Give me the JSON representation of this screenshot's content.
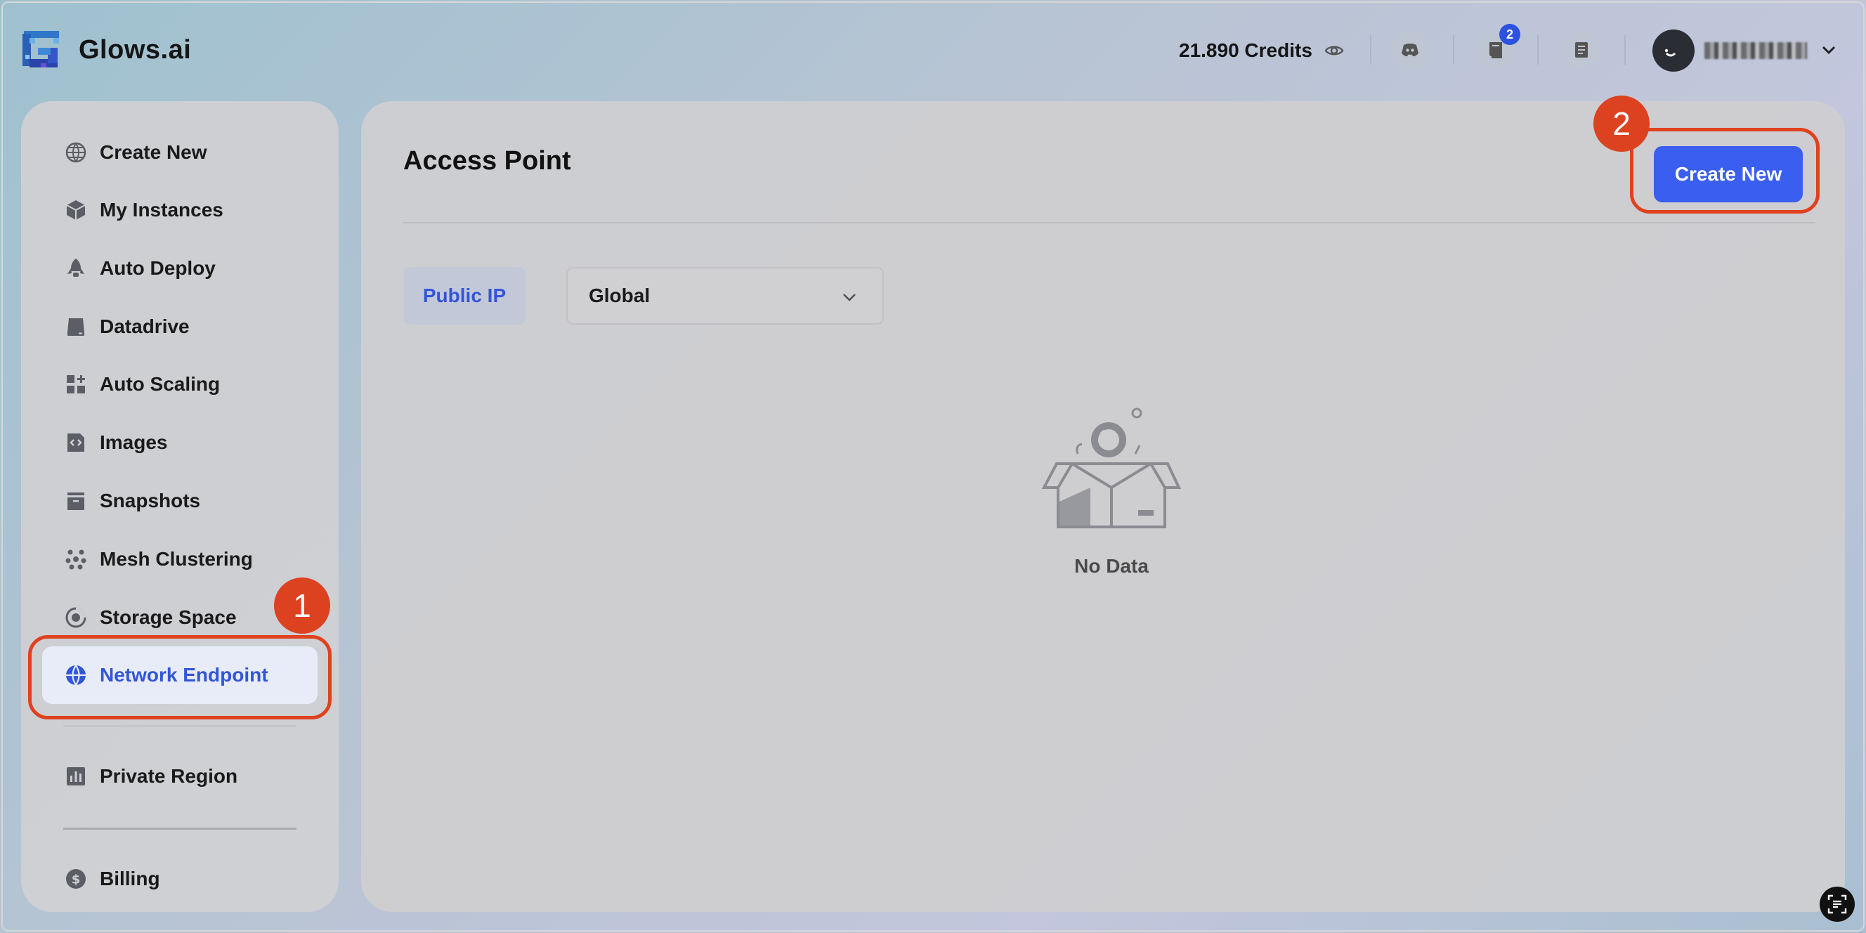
{
  "header": {
    "brand": "Glows.ai",
    "credits": "21.890 Credits",
    "notification_count": "2",
    "icons": [
      "eye-icon",
      "discord-icon",
      "book-icon",
      "document-icon",
      "chevron-down-icon"
    ]
  },
  "sidebar": {
    "items": [
      {
        "label": "Create New",
        "icon": "globe-grid-icon"
      },
      {
        "label": "My Instances",
        "icon": "cube-icon"
      },
      {
        "label": "Auto Deploy",
        "icon": "rocket-icon"
      },
      {
        "label": "Datadrive",
        "icon": "drive-icon"
      },
      {
        "label": "Auto Scaling",
        "icon": "grid-plus-icon"
      },
      {
        "label": "Images",
        "icon": "code-file-icon"
      },
      {
        "label": "Snapshots",
        "icon": "archive-icon"
      },
      {
        "label": "Mesh Clustering",
        "icon": "cluster-icon"
      },
      {
        "label": "Storage Space",
        "icon": "disc-icon"
      },
      {
        "label": "Network Endpoint",
        "icon": "globe-icon",
        "active": true
      },
      {
        "label": "Private Region",
        "icon": "chart-icon"
      },
      {
        "label": "Billing",
        "icon": "dollar-icon"
      }
    ]
  },
  "main": {
    "title": "Access Point",
    "create_label": "Create New",
    "tab_label": "Public IP",
    "region_value": "Global",
    "empty_text": "No Data"
  },
  "callouts": [
    "1",
    "2"
  ],
  "colors": {
    "accent": "#3a5ef0",
    "active_text": "#3256d8",
    "callout": "#e0411f",
    "badge": "#2d52e0"
  }
}
